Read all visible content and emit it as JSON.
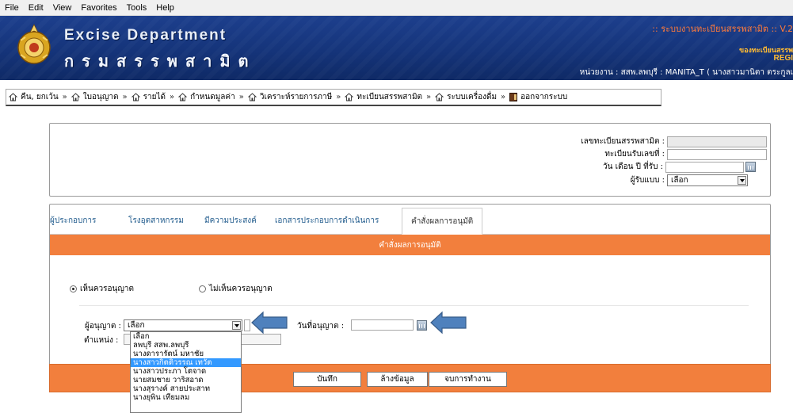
{
  "menu": [
    "File",
    "Edit",
    "View",
    "Favorites",
    "Tools",
    "Help"
  ],
  "header": {
    "brand_en": "Excise Department",
    "brand_th": "กรมสรรพสามิต",
    "system_title": ":: ระบบงานทะเบียนสรรพสามิต :: V.2",
    "sub_title": "ของทะเบียนสรรพ",
    "region": "REGI",
    "user_info": "หน่วยงาน : สสพ.ลพบุรี : MANITA_T ( นางสาวมานิตา ตระกูลเ"
  },
  "nav": [
    "คืน, ยกเว้น",
    "ใบอนุญาต",
    "รายได้",
    "กำหนดมูลค่า",
    "วิเคราะห์รายการภาษี",
    "ทะเบียนสรรพสามิต",
    "ระบบเครื่องดื่ม",
    "ออกจากระบบ"
  ],
  "top_form": {
    "reg_no_label": "เลขทะเบียนสรรพสามิต :",
    "receipt_no_label": "ทะเบียนรับเลขที่ :",
    "receive_date_label": "วัน เดือน ปี ที่รับ :",
    "receiver_label": "ผู้รับแบบ :",
    "receiver_value": "เลือก"
  },
  "tabs": [
    "ผู้ประกอบการ",
    "โรงอุตสาหกรรม",
    "มีความประสงค์",
    "เอกสารประกอบการดำเนินการ",
    "คำสั่งผลการอนุมัติ"
  ],
  "section_title": "คำสั่งผลการอนุมัติ",
  "radios": {
    "approve": "เห็นควรอนุญาต",
    "reject": "ไม่เห็นควรอนุญาต"
  },
  "approver": {
    "label": "ผู้อนุญาต :",
    "value": "เลือก",
    "position_label": "ตำแหน่ง :",
    "date_label": "วันที่อนุญาต :"
  },
  "dropdown_options": [
    "เลือก",
    "ลพบุรี สสพ.ลพบุรี",
    "นางดารารัตน์ มหาชัย",
    "นางสาวกิตติวรรณ เทวัต",
    "นางสาวประภา โตจาด",
    "นายสมชาย วาริสอาด",
    "นางสุรางค์ สายประสาท",
    "นางยุพิน เทียมลม"
  ],
  "buttons": {
    "save": "บันทึก",
    "clear": "ล้างข้อมูล",
    "finish": "จบการทำงาน"
  },
  "colors": {
    "header_blue": "#15347a",
    "orange": "#f27f3d",
    "highlight": "#3399ff",
    "annotation_arrow": "#4f81bd"
  }
}
